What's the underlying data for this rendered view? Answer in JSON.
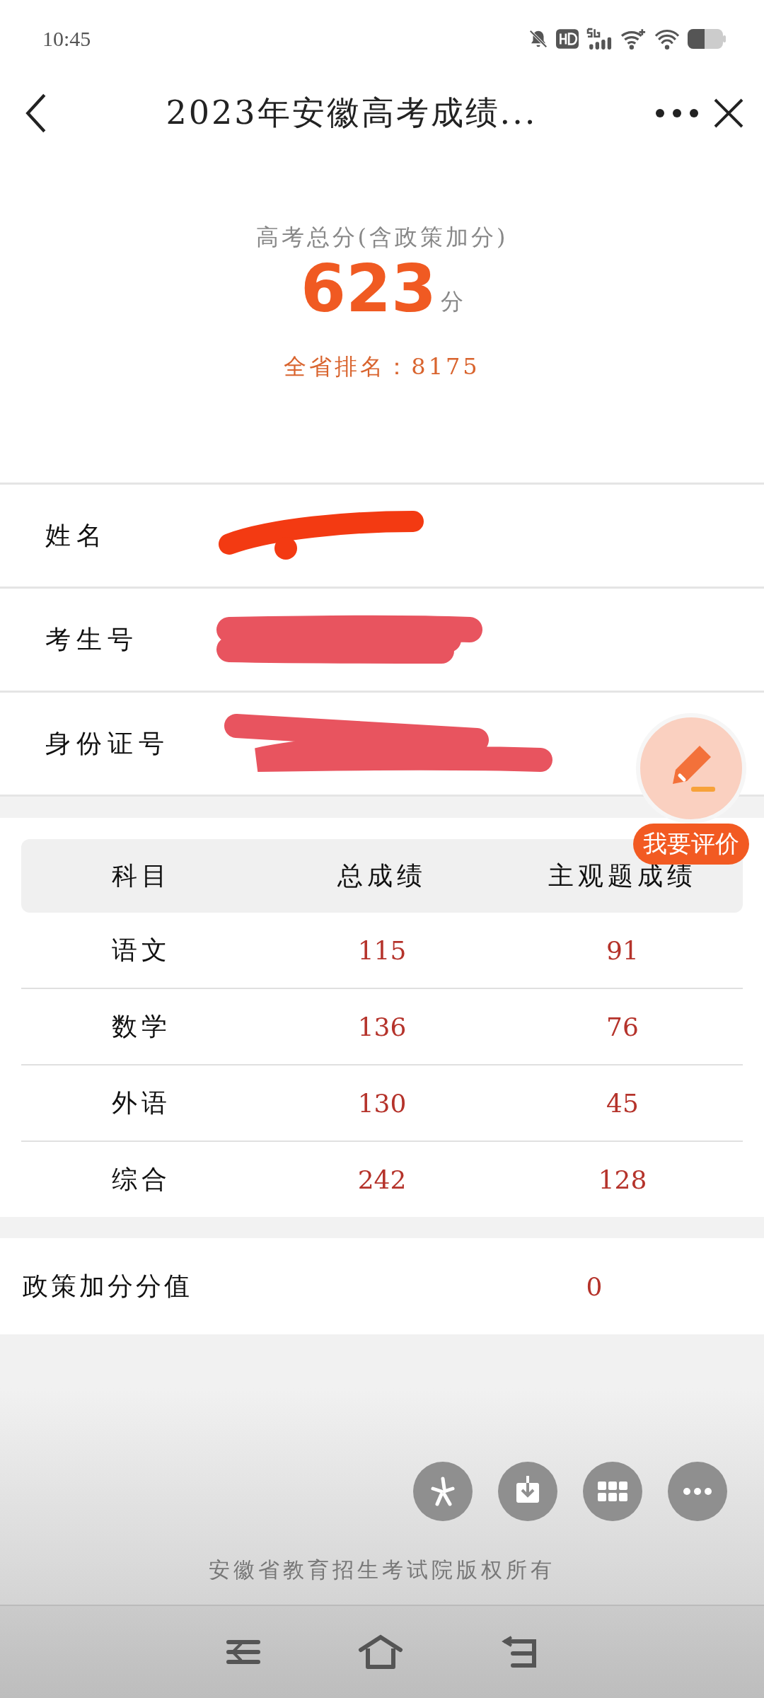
{
  "status_bar": {
    "time": "10:45"
  },
  "nav": {
    "title": "2023年安徽高考成绩..."
  },
  "score": {
    "caption": "高考总分(含政策加分)",
    "total": "623",
    "unit": "分",
    "rank": "全省排名：8175"
  },
  "info": [
    {
      "label": "姓名",
      "redacted": true
    },
    {
      "label": "考生号",
      "redacted": true
    },
    {
      "label": "身份证号",
      "redacted": true
    }
  ],
  "rate_button": {
    "label": "我要评价"
  },
  "table": {
    "columns": [
      "科目",
      "总成绩",
      "主观题成绩"
    ],
    "rows": [
      [
        "语文",
        "115",
        "91"
      ],
      [
        "数学",
        "136",
        "76"
      ],
      [
        "外语",
        "130",
        "45"
      ],
      [
        "综合",
        "242",
        "128"
      ]
    ]
  },
  "bonus": {
    "label": "政策加分分值",
    "value": "0"
  },
  "footer": {
    "text": "安徽省教育招生考试院版权所有"
  }
}
